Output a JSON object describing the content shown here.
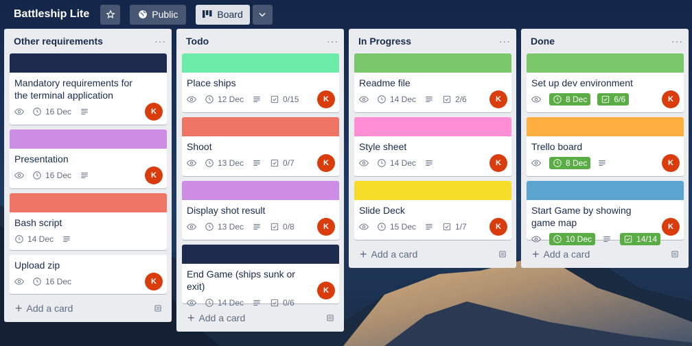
{
  "header": {
    "title": "Battleship Lite",
    "visibility": "Public",
    "view": "Board"
  },
  "lists": [
    {
      "title": "Other requirements",
      "add_card": "Add a card",
      "cards": [
        {
          "title": "Mandatory requirements for the terminal application",
          "cover": "#1f2b4e",
          "date": "16 Dec",
          "date_done": false,
          "watch": true,
          "desc": true,
          "checklist": "",
          "member": "K"
        },
        {
          "title": "Presentation",
          "cover": "#cd8de5",
          "date": "16 Dec",
          "date_done": false,
          "watch": true,
          "desc": true,
          "checklist": "",
          "member": "K"
        },
        {
          "title": "Bash script",
          "cover": "#ef7564",
          "date": "14 Dec",
          "date_done": false,
          "watch": false,
          "desc": true,
          "checklist": "",
          "member": ""
        },
        {
          "title": "Upload zip",
          "cover": "",
          "date": "16 Dec",
          "date_done": false,
          "watch": true,
          "desc": false,
          "checklist": "",
          "member": "K"
        }
      ]
    },
    {
      "title": "Todo",
      "add_card": "Add a card",
      "cards": [
        {
          "title": "Place ships",
          "cover": "#6deca9",
          "date": "12 Dec",
          "date_done": false,
          "watch": true,
          "desc": true,
          "checklist": "0/15",
          "member": "K"
        },
        {
          "title": "Shoot",
          "cover": "#ef7564",
          "date": "13 Dec",
          "date_done": false,
          "watch": true,
          "desc": true,
          "checklist": "0/7",
          "member": "K"
        },
        {
          "title": "Display shot result",
          "cover": "#cd8de5",
          "date": "13 Dec",
          "date_done": false,
          "watch": true,
          "desc": true,
          "checklist": "0/8",
          "member": "K"
        },
        {
          "title": "End Game (ships sunk or exit)",
          "cover": "#1f2b4e",
          "date": "14 Dec",
          "date_done": false,
          "watch": true,
          "desc": true,
          "checklist": "0/6",
          "member": "K"
        }
      ]
    },
    {
      "title": "In Progress",
      "add_card": "Add a card",
      "cards": [
        {
          "title": "Readme file",
          "cover": "#7bc86c",
          "date": "14 Dec",
          "date_done": false,
          "watch": true,
          "desc": true,
          "checklist": "2/6",
          "member": "K"
        },
        {
          "title": "Style sheet",
          "cover": "#ff8ed4",
          "date": "14 Dec",
          "date_done": false,
          "watch": true,
          "desc": true,
          "checklist": "",
          "member": "K"
        },
        {
          "title": "Slide Deck",
          "cover": "#f5dd29",
          "date": "15 Dec",
          "date_done": false,
          "watch": true,
          "desc": true,
          "checklist": "1/7",
          "member": "K"
        }
      ]
    },
    {
      "title": "Done",
      "add_card": "Add a card",
      "cards": [
        {
          "title": "Set up dev environment",
          "cover": "#7bc86c",
          "date": "8 Dec",
          "date_done": true,
          "watch": true,
          "desc": false,
          "checklist": "6/6",
          "checklist_done": true,
          "member": "K"
        },
        {
          "title": "Trello board",
          "cover": "#ffaf3f",
          "date": "8 Dec",
          "date_done": true,
          "watch": true,
          "desc": true,
          "checklist": "",
          "member": "K"
        },
        {
          "title": "Start Game by showing game map",
          "cover": "#5ba4cf",
          "date": "10 Dec",
          "date_done": true,
          "watch": true,
          "desc": true,
          "checklist": "14/14",
          "checklist_done": true,
          "member": "K"
        }
      ]
    }
  ]
}
